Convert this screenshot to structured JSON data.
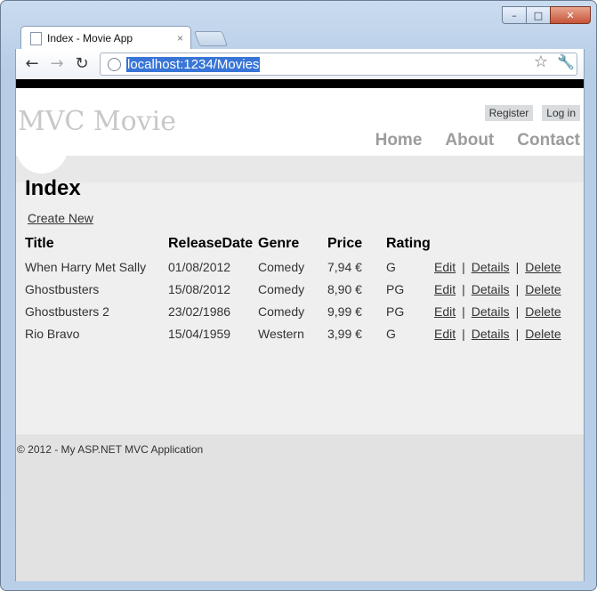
{
  "browser": {
    "tab_title": "Index - Movie App",
    "tab_close": "×",
    "url": "localhost:1234/Movies",
    "back": "←",
    "forward": "→",
    "reload": "↻",
    "star": "☆",
    "wrench": "🔧",
    "window_controls": {
      "minimize": "–",
      "maximize": "□",
      "close": "✕"
    }
  },
  "site": {
    "title": "MVC Movie",
    "login": {
      "register": "Register",
      "login": "Log in"
    },
    "menu": [
      "Home",
      "About",
      "Contact"
    ]
  },
  "main": {
    "heading": "Index",
    "create_new": "Create New",
    "table": {
      "headers": [
        "Title",
        "ReleaseDate",
        "Genre",
        "Price",
        "Rating"
      ],
      "rows": [
        [
          "When Harry Met Sally",
          "01/08/2012",
          "Comedy",
          "7,94 €",
          "G"
        ],
        [
          "Ghostbusters",
          "15/08/2012",
          "Comedy",
          "8,90 €",
          "PG"
        ],
        [
          "Ghostbusters 2",
          "23/02/1986",
          "Comedy",
          "9,99 €",
          "PG"
        ],
        [
          "Rio Bravo",
          "15/04/1959",
          "Western",
          "3,99 €",
          "G"
        ]
      ],
      "actions": {
        "edit": "Edit",
        "details": "Details",
        "delete": "Delete",
        "separator": "|"
      }
    }
  },
  "footer": {
    "text": "© 2012 - My ASP.NET MVC Application"
  }
}
